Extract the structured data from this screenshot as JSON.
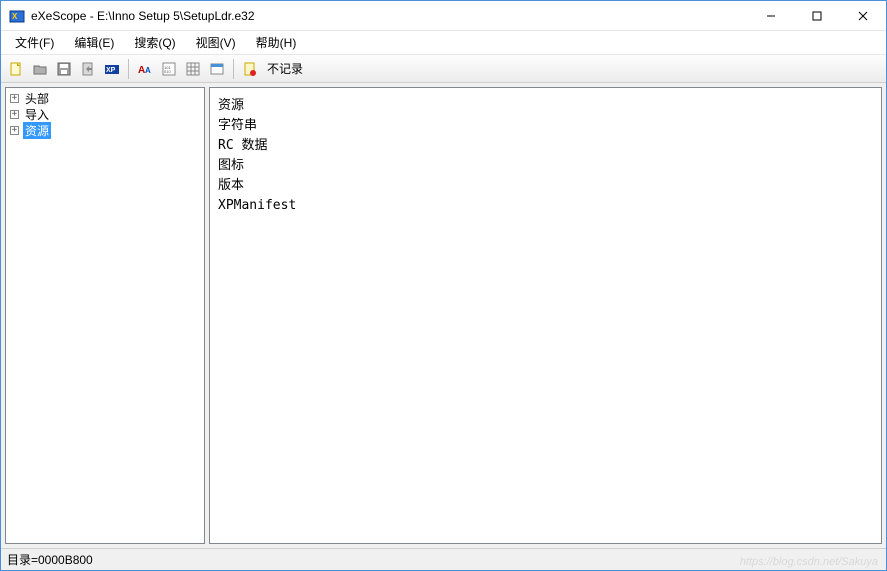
{
  "titlebar": {
    "app": "eXeScope",
    "path": "E:\\Inno Setup 5\\SetupLdr.e32",
    "full": "eXeScope - E:\\Inno Setup 5\\SetupLdr.e32"
  },
  "menubar": {
    "file": "文件(F)",
    "edit": "编辑(E)",
    "search": "搜索(Q)",
    "view": "视图(V)",
    "help": "帮助(H)"
  },
  "toolbar": {
    "norecord": "不记录"
  },
  "tree": {
    "items": [
      {
        "label": "头部",
        "selected": false
      },
      {
        "label": "导入",
        "selected": false
      },
      {
        "label": "资源",
        "selected": true
      }
    ]
  },
  "content": {
    "lines": [
      "资源",
      "字符串",
      "RC 数据",
      "图标",
      "版本",
      "XPManifest"
    ]
  },
  "statusbar": {
    "text": "目录=0000B800"
  },
  "watermark": "https://blog.csdn.net/Sakuya"
}
